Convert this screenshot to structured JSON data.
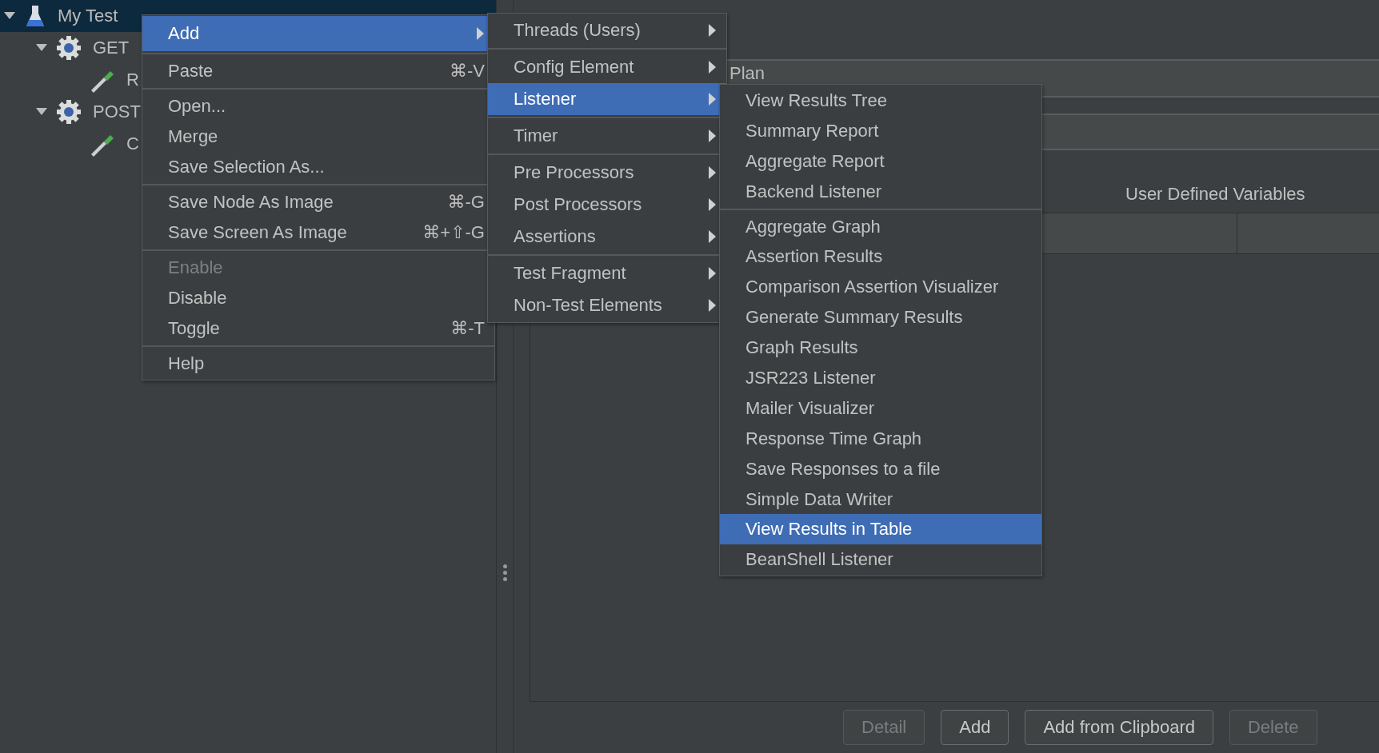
{
  "tree": [
    {
      "label": "My Test",
      "selected": true,
      "expanded": true,
      "children": [
        {
          "label": "GET",
          "selected": false,
          "expanded": true,
          "children": [
            {
              "label": "R",
              "selected": false
            }
          ]
        },
        {
          "label": "POST",
          "selected": false,
          "expanded": true,
          "children": [
            {
              "label": "C",
              "selected": false
            }
          ]
        }
      ]
    }
  ],
  "panel": {
    "label_fragment": "Plan",
    "table_title": "User Defined Variables",
    "buttons": [
      {
        "label": "Detail",
        "disabled": true
      },
      {
        "label": "Add",
        "disabled": false
      },
      {
        "label": "Add from Clipboard",
        "disabled": false
      },
      {
        "label": "Delete",
        "disabled": true
      }
    ]
  },
  "menus": [
    {
      "items": [
        {
          "kind": "item",
          "label": "Add",
          "submenu": true,
          "selected": true,
          "disabled": false
        },
        {
          "kind": "separator"
        },
        {
          "kind": "item",
          "label": "Paste",
          "shortcut": "⌘-V",
          "selected": false,
          "disabled": false
        },
        {
          "kind": "separator"
        },
        {
          "kind": "item",
          "label": "Open...",
          "selected": false,
          "disabled": false
        },
        {
          "kind": "item",
          "label": "Merge",
          "selected": false,
          "disabled": false
        },
        {
          "kind": "item",
          "label": "Save Selection As...",
          "selected": false,
          "disabled": false
        },
        {
          "kind": "separator"
        },
        {
          "kind": "item",
          "label": "Save Node As Image",
          "shortcut": "⌘-G",
          "selected": false,
          "disabled": false
        },
        {
          "kind": "item",
          "label": "Save Screen As Image",
          "shortcut": "⌘+⇧-G",
          "selected": false,
          "disabled": false
        },
        {
          "kind": "separator"
        },
        {
          "kind": "item",
          "label": "Enable",
          "selected": false,
          "disabled": true
        },
        {
          "kind": "item",
          "label": "Disable",
          "selected": false,
          "disabled": false
        },
        {
          "kind": "item",
          "label": "Toggle",
          "shortcut": "⌘-T",
          "selected": false,
          "disabled": false
        },
        {
          "kind": "separator"
        },
        {
          "kind": "item",
          "label": "Help",
          "selected": false,
          "disabled": false
        }
      ]
    },
    {
      "items": [
        {
          "kind": "item",
          "label": "Threads (Users)",
          "submenu": true,
          "selected": false,
          "disabled": false
        },
        {
          "kind": "separator"
        },
        {
          "kind": "item",
          "label": "Config Element",
          "submenu": true,
          "selected": false,
          "disabled": false
        },
        {
          "kind": "item",
          "label": "Listener",
          "submenu": true,
          "selected": true,
          "disabled": false
        },
        {
          "kind": "separator"
        },
        {
          "kind": "item",
          "label": "Timer",
          "submenu": true,
          "selected": false,
          "disabled": false
        },
        {
          "kind": "separator"
        },
        {
          "kind": "item",
          "label": "Pre Processors",
          "submenu": true,
          "selected": false,
          "disabled": false
        },
        {
          "kind": "item",
          "label": "Post Processors",
          "submenu": true,
          "selected": false,
          "disabled": false
        },
        {
          "kind": "item",
          "label": "Assertions",
          "submenu": true,
          "selected": false,
          "disabled": false
        },
        {
          "kind": "separator"
        },
        {
          "kind": "item",
          "label": "Test Fragment",
          "submenu": true,
          "selected": false,
          "disabled": false
        },
        {
          "kind": "item",
          "label": "Non-Test Elements",
          "submenu": true,
          "selected": false,
          "disabled": false
        }
      ]
    },
    {
      "items": [
        {
          "kind": "item",
          "label": "View Results Tree",
          "selected": false,
          "disabled": false
        },
        {
          "kind": "item",
          "label": "Summary Report",
          "selected": false,
          "disabled": false
        },
        {
          "kind": "item",
          "label": "Aggregate Report",
          "selected": false,
          "disabled": false
        },
        {
          "kind": "item",
          "label": "Backend Listener",
          "selected": false,
          "disabled": false
        },
        {
          "kind": "separator"
        },
        {
          "kind": "item",
          "label": "Aggregate Graph",
          "selected": false,
          "disabled": false
        },
        {
          "kind": "item",
          "label": "Assertion Results",
          "selected": false,
          "disabled": false
        },
        {
          "kind": "item",
          "label": "Comparison Assertion Visualizer",
          "selected": false,
          "disabled": false
        },
        {
          "kind": "item",
          "label": "Generate Summary Results",
          "selected": false,
          "disabled": false
        },
        {
          "kind": "item",
          "label": "Graph Results",
          "selected": false,
          "disabled": false
        },
        {
          "kind": "item",
          "label": "JSR223 Listener",
          "selected": false,
          "disabled": false
        },
        {
          "kind": "item",
          "label": "Mailer Visualizer",
          "selected": false,
          "disabled": false
        },
        {
          "kind": "item",
          "label": "Response Time Graph",
          "selected": false,
          "disabled": false
        },
        {
          "kind": "item",
          "label": "Save Responses to a file",
          "selected": false,
          "disabled": false
        },
        {
          "kind": "item",
          "label": "Simple Data Writer",
          "selected": false,
          "disabled": false
        },
        {
          "kind": "item",
          "label": "View Results in Table",
          "selected": true,
          "disabled": false
        },
        {
          "kind": "item",
          "label": "BeanShell Listener",
          "selected": false,
          "disabled": false
        }
      ]
    }
  ]
}
